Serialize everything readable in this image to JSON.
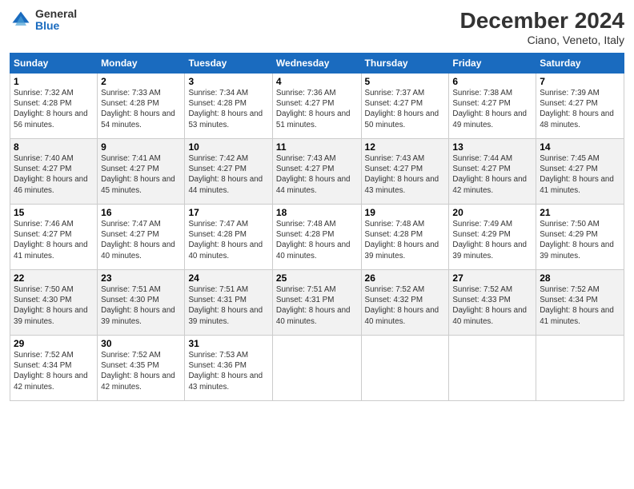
{
  "logo": {
    "general": "General",
    "blue": "Blue"
  },
  "title": "December 2024",
  "location": "Ciano, Veneto, Italy",
  "days_of_week": [
    "Sunday",
    "Monday",
    "Tuesday",
    "Wednesday",
    "Thursday",
    "Friday",
    "Saturday"
  ],
  "weeks": [
    [
      {
        "day": "1",
        "sunrise": "7:32 AM",
        "sunset": "4:28 PM",
        "daylight": "8 hours and 56 minutes."
      },
      {
        "day": "2",
        "sunrise": "7:33 AM",
        "sunset": "4:28 PM",
        "daylight": "8 hours and 54 minutes."
      },
      {
        "day": "3",
        "sunrise": "7:34 AM",
        "sunset": "4:28 PM",
        "daylight": "8 hours and 53 minutes."
      },
      {
        "day": "4",
        "sunrise": "7:36 AM",
        "sunset": "4:27 PM",
        "daylight": "8 hours and 51 minutes."
      },
      {
        "day": "5",
        "sunrise": "7:37 AM",
        "sunset": "4:27 PM",
        "daylight": "8 hours and 50 minutes."
      },
      {
        "day": "6",
        "sunrise": "7:38 AM",
        "sunset": "4:27 PM",
        "daylight": "8 hours and 49 minutes."
      },
      {
        "day": "7",
        "sunrise": "7:39 AM",
        "sunset": "4:27 PM",
        "daylight": "8 hours and 48 minutes."
      }
    ],
    [
      {
        "day": "8",
        "sunrise": "7:40 AM",
        "sunset": "4:27 PM",
        "daylight": "8 hours and 46 minutes."
      },
      {
        "day": "9",
        "sunrise": "7:41 AM",
        "sunset": "4:27 PM",
        "daylight": "8 hours and 45 minutes."
      },
      {
        "day": "10",
        "sunrise": "7:42 AM",
        "sunset": "4:27 PM",
        "daylight": "8 hours and 44 minutes."
      },
      {
        "day": "11",
        "sunrise": "7:43 AM",
        "sunset": "4:27 PM",
        "daylight": "8 hours and 44 minutes."
      },
      {
        "day": "12",
        "sunrise": "7:43 AM",
        "sunset": "4:27 PM",
        "daylight": "8 hours and 43 minutes."
      },
      {
        "day": "13",
        "sunrise": "7:44 AM",
        "sunset": "4:27 PM",
        "daylight": "8 hours and 42 minutes."
      },
      {
        "day": "14",
        "sunrise": "7:45 AM",
        "sunset": "4:27 PM",
        "daylight": "8 hours and 41 minutes."
      }
    ],
    [
      {
        "day": "15",
        "sunrise": "7:46 AM",
        "sunset": "4:27 PM",
        "daylight": "8 hours and 41 minutes."
      },
      {
        "day": "16",
        "sunrise": "7:47 AM",
        "sunset": "4:27 PM",
        "daylight": "8 hours and 40 minutes."
      },
      {
        "day": "17",
        "sunrise": "7:47 AM",
        "sunset": "4:28 PM",
        "daylight": "8 hours and 40 minutes."
      },
      {
        "day": "18",
        "sunrise": "7:48 AM",
        "sunset": "4:28 PM",
        "daylight": "8 hours and 40 minutes."
      },
      {
        "day": "19",
        "sunrise": "7:48 AM",
        "sunset": "4:28 PM",
        "daylight": "8 hours and 39 minutes."
      },
      {
        "day": "20",
        "sunrise": "7:49 AM",
        "sunset": "4:29 PM",
        "daylight": "8 hours and 39 minutes."
      },
      {
        "day": "21",
        "sunrise": "7:50 AM",
        "sunset": "4:29 PM",
        "daylight": "8 hours and 39 minutes."
      }
    ],
    [
      {
        "day": "22",
        "sunrise": "7:50 AM",
        "sunset": "4:30 PM",
        "daylight": "8 hours and 39 minutes."
      },
      {
        "day": "23",
        "sunrise": "7:51 AM",
        "sunset": "4:30 PM",
        "daylight": "8 hours and 39 minutes."
      },
      {
        "day": "24",
        "sunrise": "7:51 AM",
        "sunset": "4:31 PM",
        "daylight": "8 hours and 39 minutes."
      },
      {
        "day": "25",
        "sunrise": "7:51 AM",
        "sunset": "4:31 PM",
        "daylight": "8 hours and 40 minutes."
      },
      {
        "day": "26",
        "sunrise": "7:52 AM",
        "sunset": "4:32 PM",
        "daylight": "8 hours and 40 minutes."
      },
      {
        "day": "27",
        "sunrise": "7:52 AM",
        "sunset": "4:33 PM",
        "daylight": "8 hours and 40 minutes."
      },
      {
        "day": "28",
        "sunrise": "7:52 AM",
        "sunset": "4:34 PM",
        "daylight": "8 hours and 41 minutes."
      }
    ],
    [
      {
        "day": "29",
        "sunrise": "7:52 AM",
        "sunset": "4:34 PM",
        "daylight": "8 hours and 42 minutes."
      },
      {
        "day": "30",
        "sunrise": "7:52 AM",
        "sunset": "4:35 PM",
        "daylight": "8 hours and 42 minutes."
      },
      {
        "day": "31",
        "sunrise": "7:53 AM",
        "sunset": "4:36 PM",
        "daylight": "8 hours and 43 minutes."
      },
      null,
      null,
      null,
      null
    ]
  ],
  "labels": {
    "sunrise": "Sunrise:",
    "sunset": "Sunset:",
    "daylight": "Daylight:"
  }
}
